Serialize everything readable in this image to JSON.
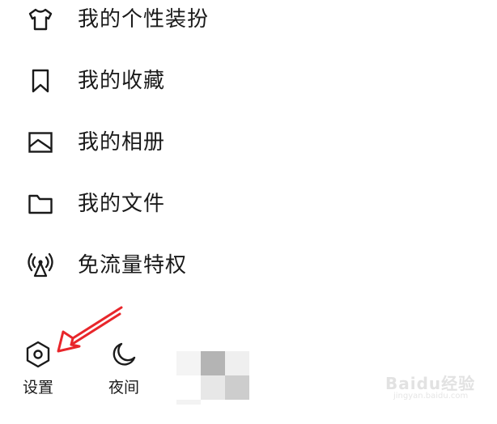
{
  "menu": {
    "items": [
      {
        "label": "我的个性装扮",
        "icon": "tshirt-icon"
      },
      {
        "label": "我的收藏",
        "icon": "bookmark-icon"
      },
      {
        "label": "我的相册",
        "icon": "image-icon"
      },
      {
        "label": "我的文件",
        "icon": "folder-icon"
      },
      {
        "label": "免流量特权",
        "icon": "signal-tower-icon"
      }
    ]
  },
  "bottom_bar": {
    "settings_label": "设置",
    "night_label": "夜间"
  },
  "annotation": {
    "arrow_color": "#e8262b"
  },
  "watermark": {
    "text": "Baidu经验",
    "sub": "jingyan.baidu.com"
  },
  "colors": {
    "text": "#1a1a1a",
    "background": "#ffffff"
  }
}
